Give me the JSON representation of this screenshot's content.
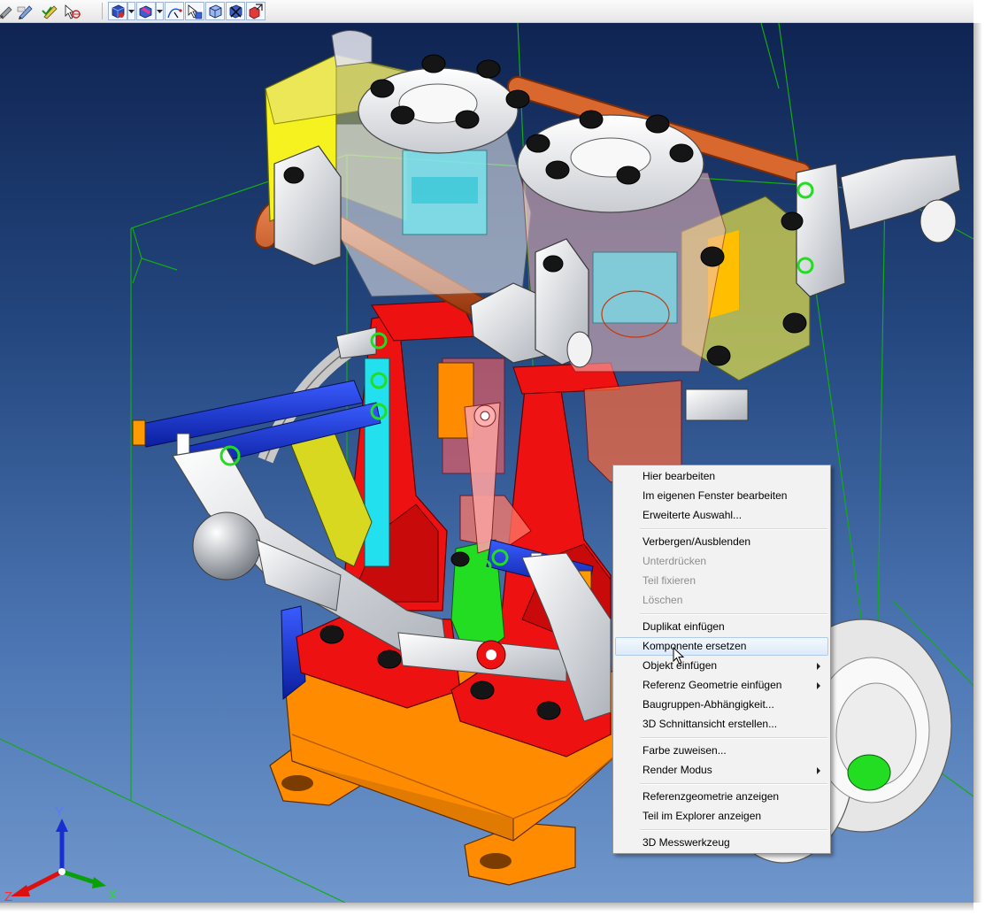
{
  "toolbar": {
    "icons": [
      "pencil-wrench-icon",
      "pen-icon",
      "pen-check-icon",
      "pointer-target-icon",
      "cube-select-icon",
      "dropdown-arrow-icon",
      "cube-paint-icon",
      "dropdown-arrow-icon",
      "curve-edit-icon",
      "pointer-cube-icon",
      "cube-outline-icon",
      "cube-delete-icon",
      "cube-replace-icon"
    ]
  },
  "viewport": {
    "background_top": "#0f2452",
    "background_bottom": "#6f97cc",
    "part_colors": {
      "base": "#ff8c00",
      "frame": "#ee1111",
      "rods": "#1a3adf",
      "cylinder": "#d8d8d8",
      "pipe": "#c9521e",
      "valve_chest": "#e8e24a",
      "handle": "#c9c9c9",
      "accent": "#22dd22",
      "cyan": "#22e0ee",
      "bbox": "#14aa14"
    }
  },
  "axes": {
    "x": "X",
    "y": "Y",
    "z": "Z"
  },
  "context_menu": {
    "items": [
      {
        "label": "Hier bearbeiten",
        "enabled": true
      },
      {
        "label": "Im eigenen Fenster bearbeiten",
        "enabled": true
      },
      {
        "label": "Erweiterte Auswahl...",
        "enabled": true
      },
      {
        "label": "Verbergen/Ausblenden",
        "enabled": true
      },
      {
        "label": "Unterdrücken",
        "enabled": false
      },
      {
        "label": "Teil fixieren",
        "enabled": false
      },
      {
        "label": "Löschen",
        "enabled": false
      },
      {
        "label": "Duplikat einfügen",
        "enabled": true
      },
      {
        "label": "Komponente ersetzen",
        "enabled": true,
        "highlighted": true
      },
      {
        "label": "Objekt einfügen",
        "enabled": true,
        "submenu": true
      },
      {
        "label": "Referenz Geometrie einfügen",
        "enabled": true,
        "submenu": true
      },
      {
        "label": "Baugruppen-Abhängigkeit...",
        "enabled": true
      },
      {
        "label": "3D Schnittansicht erstellen...",
        "enabled": true
      },
      {
        "label": "Farbe zuweisen...",
        "enabled": true
      },
      {
        "label": "Render Modus",
        "enabled": true,
        "submenu": true
      },
      {
        "label": "Referenzgeometrie anzeigen",
        "enabled": true
      },
      {
        "label": "Teil im Explorer anzeigen",
        "enabled": true
      },
      {
        "label": "3D Messwerkzeug",
        "enabled": true
      }
    ]
  }
}
